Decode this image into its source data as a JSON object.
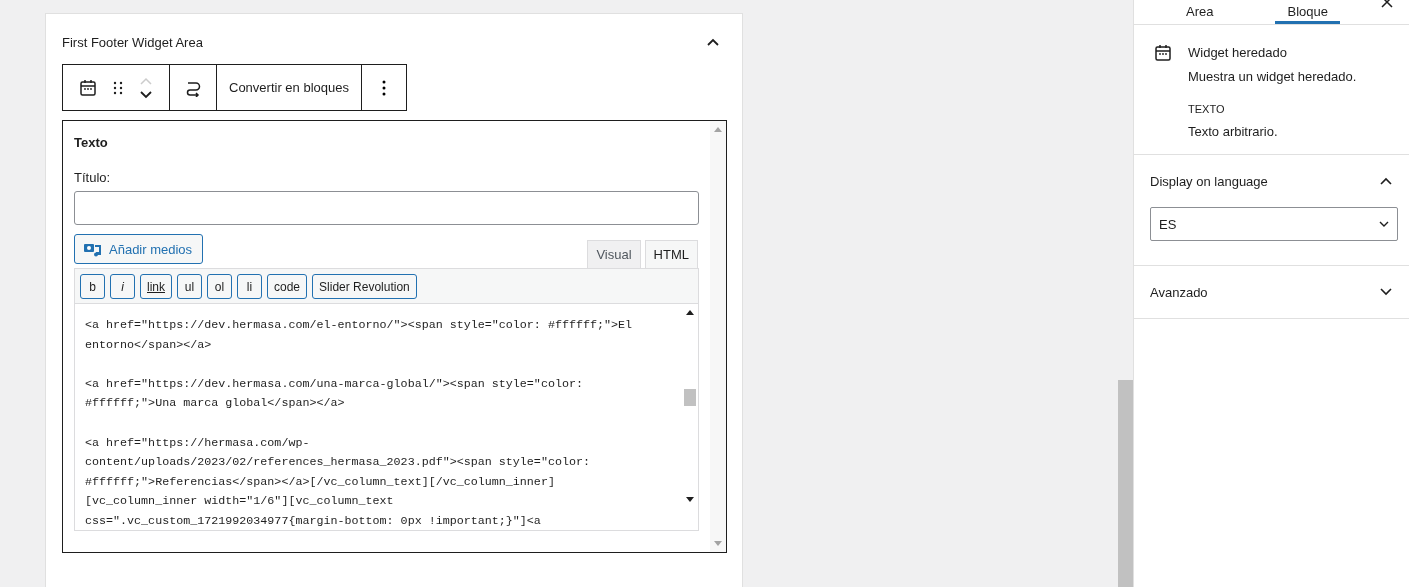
{
  "area": {
    "title": "First Footer Widget Area",
    "expanded": true
  },
  "toolbar": {
    "convert_label": "Convertir en bloques"
  },
  "widget": {
    "title": "Texto",
    "field_label": "Título:",
    "media_button": "Añadir medios",
    "editor_tabs": [
      {
        "label": "Visual",
        "selected": false
      },
      {
        "label": "HTML",
        "selected": true
      }
    ],
    "quicktags": [
      "b",
      "i",
      "link",
      "ul",
      "ol",
      "li",
      "code",
      "Slider Revolution"
    ],
    "code_paragraphs": [
      [
        "<a href=\"https://dev.hermasa.com/el-entorno/\"><span style=\"color: #ffffff;\">El",
        "entorno</span></a>"
      ],
      [
        "<a href=\"https://dev.hermasa.com/una-marca-global/\"><span style=\"color:",
        "#ffffff;\">Una marca global</span></a>"
      ],
      [
        "<a href=\"https://hermasa.com/wp-",
        "content/uploads/2023/02/references_hermasa_2023.pdf\"><span style=\"color:",
        "#ffffff;\">Referencias</span></a>[/vc_column_text][/vc_column_inner]",
        "[vc_column_inner width=\"1/6\"][vc_column_text",
        "css=\".vc_custom_1721992034977{margin-bottom: 0px !important;}\"]<a"
      ]
    ]
  },
  "sidebar": {
    "tabs": [
      {
        "label": "Area",
        "selected": false
      },
      {
        "label": "Bloque",
        "selected": true
      }
    ],
    "block_name": "Widget heredado",
    "block_desc": "Muestra un widget heredado.",
    "widget_type": "TEXTO",
    "widget_desc": "Texto arbitrario.",
    "panels": [
      {
        "title": "Display on language",
        "expanded": true,
        "select_value": "ES"
      },
      {
        "title": "Avanzado",
        "expanded": false
      }
    ]
  }
}
